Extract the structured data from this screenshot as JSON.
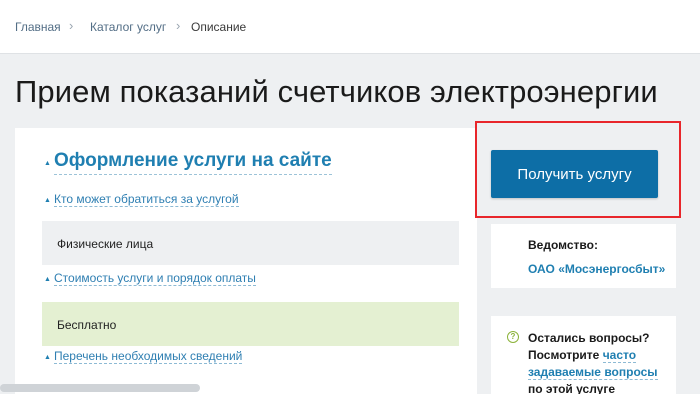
{
  "breadcrumb": {
    "items": [
      "Главная",
      "Каталог услуг",
      "Описание"
    ],
    "separator": "›"
  },
  "page": {
    "title": "Прием показаний счетчиков электроэнергии"
  },
  "main": {
    "section_heading": "Оформление услуги на сайте",
    "sections": [
      {
        "link": "Кто может обратиться за услугой",
        "value": "Физические лица"
      },
      {
        "link": "Стоимость услуги и порядок оплаты",
        "value": "Бесплатно"
      },
      {
        "link": "Перечень необходимых сведений"
      }
    ]
  },
  "sidebar": {
    "get_service_label": "Получить услугу",
    "department_label": "Ведомство:",
    "department_name": "ОАО «Мосэнергосбыт»",
    "questions": {
      "icon": "question-circle-icon",
      "line1": "Остались вопросы?",
      "line2_prefix": "Посмотрите ",
      "line2_link": "часто",
      "line3_link": "задаваемые вопросы",
      "line4": "по этой услуге"
    }
  },
  "colors": {
    "accent": "#1f7fb1",
    "button": "#0d6ea6",
    "highlight": "#e8262b",
    "paid_box": "#e4f0d2",
    "info_box": "#eef0f2"
  }
}
